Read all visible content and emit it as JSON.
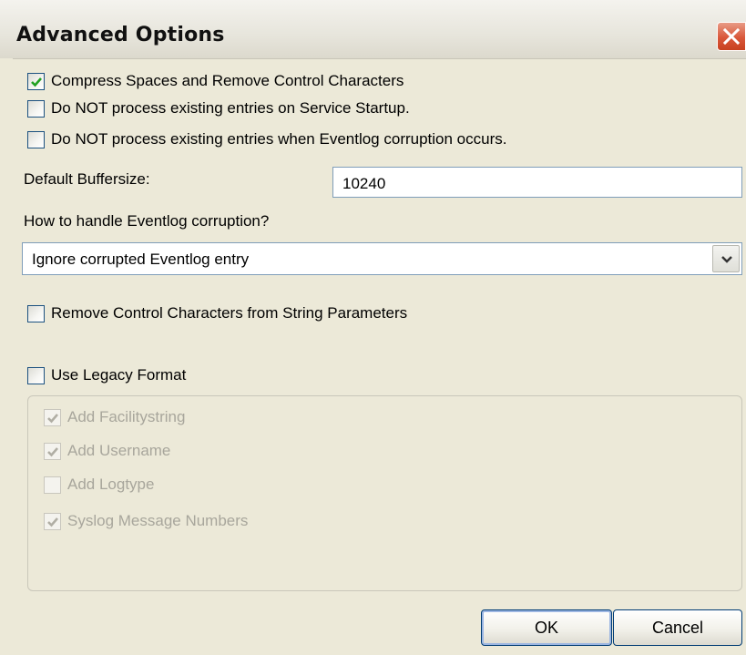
{
  "window": {
    "title": "Advanced Options"
  },
  "options": {
    "compress_spaces": {
      "label": "Compress Spaces and Remove Control Characters",
      "checked": true
    },
    "no_process_startup": {
      "label": "Do NOT process existing entries on Service Startup.",
      "checked": false
    },
    "no_process_corruption": {
      "label": "Do NOT process existing entries when Eventlog corruption occurs.",
      "checked": false
    }
  },
  "buffer": {
    "label": "Default Buffersize:",
    "value": "10240"
  },
  "corruption": {
    "label": "How to handle Eventlog corruption?",
    "selected": "Ignore corrupted Eventlog entry"
  },
  "remove_control_chars": {
    "label": "Remove Control Characters from String Parameters",
    "checked": false
  },
  "legacy": {
    "label": "Use Legacy Format",
    "checked": false,
    "items": [
      {
        "label": "Add Facilitystring",
        "checked": true
      },
      {
        "label": "Add Username",
        "checked": true
      },
      {
        "label": "Add Logtype",
        "checked": false
      },
      {
        "label": "Syslog Message Numbers",
        "checked": true
      }
    ]
  },
  "buttons": {
    "ok": "OK",
    "cancel": "Cancel"
  },
  "colors": {
    "check_enabled": "#21a121",
    "check_disabled": "#b0aea4",
    "close_button": "#d9573a"
  }
}
